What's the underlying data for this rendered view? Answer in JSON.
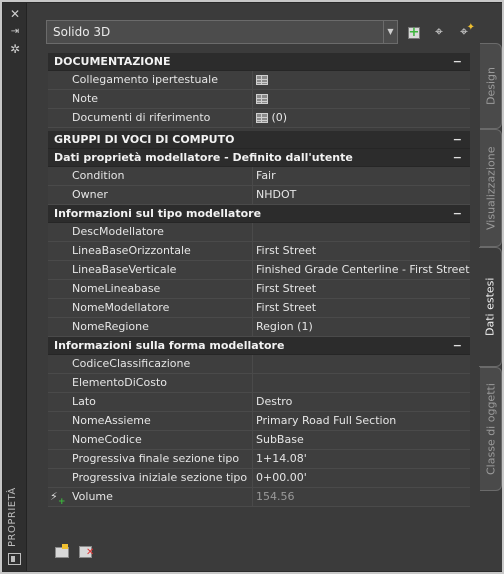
{
  "titlebar": {
    "label": "PROPRIETÀ"
  },
  "selector": {
    "value": "Solido 3D"
  },
  "sections": {
    "documentazione": "DOCUMENTAZIONE",
    "gruppi": "GRUPPI DI VOCI DI COMPUTO",
    "dati_prop": "Dati proprietà modellatore - Definito dall'utente",
    "info_tipo": "Informazioni sul tipo modellatore",
    "info_forma": "Informazioni sulla forma modellatore"
  },
  "documentazione_rows": [
    {
      "name": "Collegamento ipertestuale",
      "value": ""
    },
    {
      "name": "Note",
      "value": ""
    },
    {
      "name": "Documenti di riferimento",
      "value": "(0)"
    }
  ],
  "dati_prop_rows": [
    {
      "name": "Condition",
      "value": "Fair"
    },
    {
      "name": "Owner",
      "value": "NHDOT"
    }
  ],
  "info_tipo_rows": [
    {
      "name": "DescModellatore",
      "value": ""
    },
    {
      "name": "LineaBaseOrizzontale",
      "value": "First Street"
    },
    {
      "name": "LineaBaseVerticale",
      "value": "Finished Grade Centerline - First Street"
    },
    {
      "name": "NomeLineabase",
      "value": "First Street"
    },
    {
      "name": "NomeModellatore",
      "value": "First Street"
    },
    {
      "name": "NomeRegione",
      "value": "Region (1)"
    }
  ],
  "info_forma_rows": [
    {
      "name": "CodiceClassificazione",
      "value": ""
    },
    {
      "name": "ElementoDiCosto",
      "value": ""
    },
    {
      "name": "Lato",
      "value": "Destro"
    },
    {
      "name": "NomeAssieme",
      "value": "Primary Road Full Section"
    },
    {
      "name": "NomeCodice",
      "value": "SubBase"
    },
    {
      "name": "Progressiva finale sezione tipo",
      "value": "1+14.08'"
    },
    {
      "name": "Progressiva iniziale sezione tipo",
      "value": "0+00.00'"
    },
    {
      "name": "Volume",
      "value": "154.56"
    }
  ],
  "tabs": [
    "Design",
    "Visualizzazione",
    "Dati estesi",
    "Classe di oggetti"
  ],
  "active_tab": "Dati estesi",
  "icons": {
    "close": "close-icon",
    "autohide": "autohide-icon",
    "settings": "settings-icon",
    "add_property_set": "add-property-set-icon",
    "select_objects": "select-objects-icon",
    "quick_select": "quick-select-icon",
    "table": "table-icon",
    "volume": "volume-icon",
    "edit_property_sets": "edit-property-sets-icon",
    "remove_property_sets": "remove-property-sets-icon"
  }
}
